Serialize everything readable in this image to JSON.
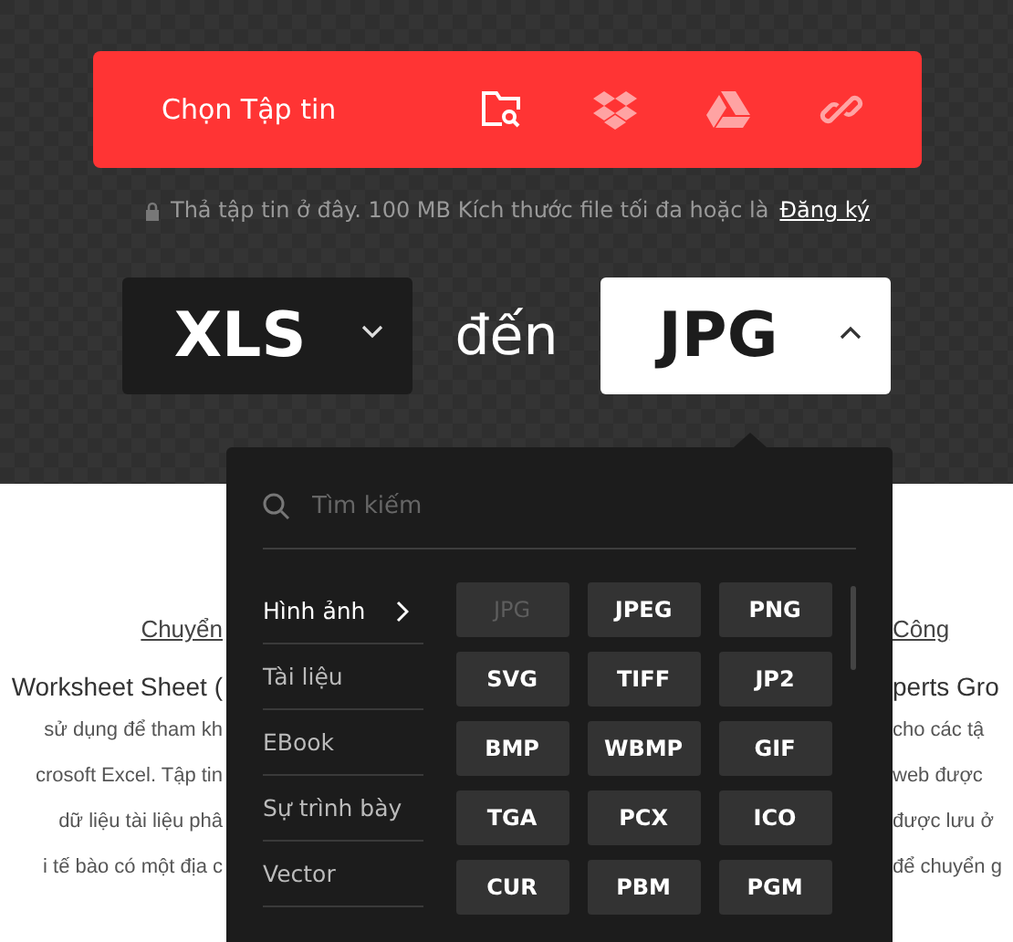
{
  "upload": {
    "button": "Chọn Tập tin",
    "sources": [
      {
        "kind": "folder",
        "active": true
      },
      {
        "kind": "dropbox",
        "active": false
      },
      {
        "kind": "drive",
        "active": false
      },
      {
        "kind": "link",
        "active": false
      }
    ]
  },
  "note": {
    "text": "Thả tập tin ở đây. 100 MB Kích thước file tối đa hoặc là",
    "link": "Đăng ký"
  },
  "converter": {
    "from": "XLS",
    "joiner": "đến",
    "to": "JPG",
    "to_expanded": true
  },
  "background_page": {
    "left": {
      "link": "Chuyển",
      "heading": "Worksheet Sheet (",
      "lines": [
        "sử dụng để tham kh",
        "crosoft Excel. Tập tin",
        "dữ liệu tài liệu phâ",
        "i tế bào có một địa c"
      ]
    },
    "right": {
      "link": "Công",
      "heading": "perts Gro",
      "lines": [
        "cho các tậ",
        "web được",
        "được lưu ở",
        "để chuyển g"
      ]
    }
  },
  "dropdown": {
    "search": {
      "placeholder": "Tìm kiếm"
    },
    "categories": [
      {
        "label": "Hình ảnh",
        "selected": true
      },
      {
        "label": "Tài liệu",
        "selected": false
      },
      {
        "label": "EBook",
        "selected": false
      },
      {
        "label": "Sự trình bày",
        "selected": false
      },
      {
        "label": "Vector",
        "selected": false
      }
    ],
    "formats": [
      {
        "label": "JPG",
        "disabled": true
      },
      {
        "label": "JPEG",
        "disabled": false
      },
      {
        "label": "PNG",
        "disabled": false
      },
      {
        "label": "SVG",
        "disabled": false
      },
      {
        "label": "TIFF",
        "disabled": false
      },
      {
        "label": "JP2",
        "disabled": false
      },
      {
        "label": "BMP",
        "disabled": false
      },
      {
        "label": "WBMP",
        "disabled": false
      },
      {
        "label": "GIF",
        "disabled": false
      },
      {
        "label": "TGA",
        "disabled": false
      },
      {
        "label": "PCX",
        "disabled": false
      },
      {
        "label": "ICO",
        "disabled": false
      },
      {
        "label": "CUR",
        "disabled": false
      },
      {
        "label": "PBM",
        "disabled": false
      },
      {
        "label": "PGM",
        "disabled": false
      }
    ]
  }
}
